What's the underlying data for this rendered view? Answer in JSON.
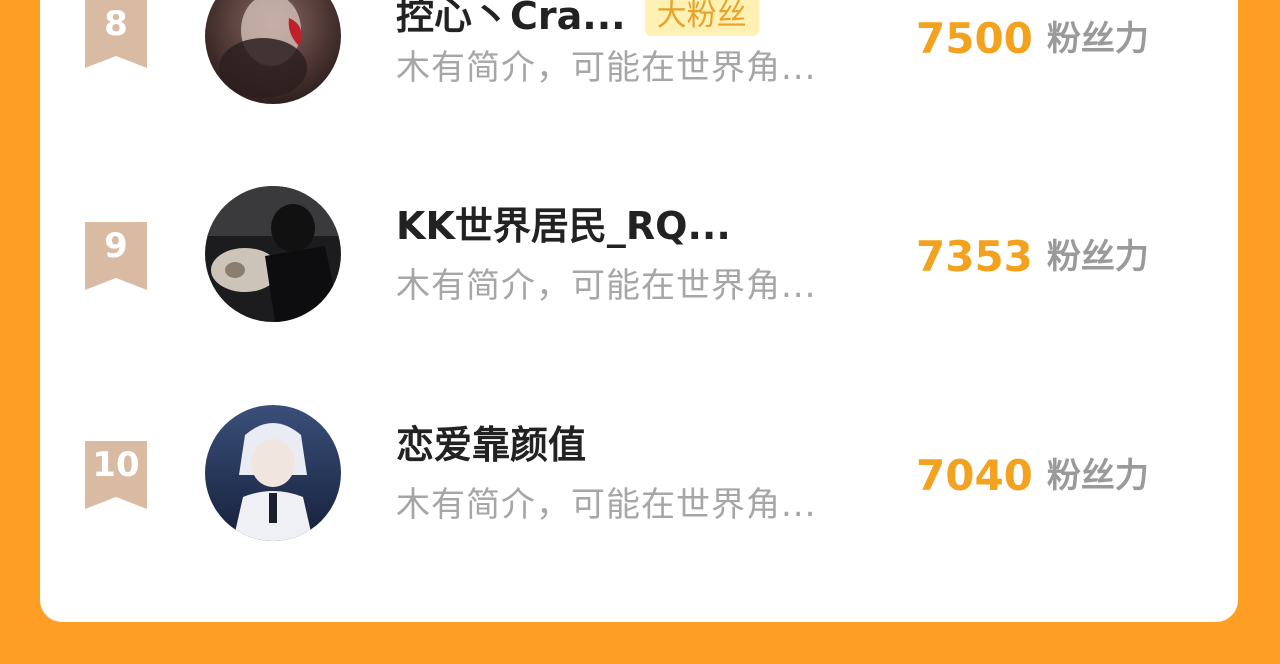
{
  "score_unit": "粉丝力",
  "colors": {
    "background": "#FF9E24",
    "card": "#FFFFFF",
    "rank_badge": "#D9BBA4",
    "score": "#F3A21F",
    "badge_bg": "#FFF0B3",
    "badge_text": "#E7A22A"
  },
  "rows": [
    {
      "rank": "8",
      "name": "控心丶Cra...",
      "badge": "大粉丝",
      "bio": "木有简介，可能在世界角...",
      "score": "7500"
    },
    {
      "rank": "9",
      "name": "KK世界居民_RQ...",
      "bio": "木有简介，可能在世界角...",
      "score": "7353"
    },
    {
      "rank": "10",
      "name": "恋爱靠颜值",
      "bio": "木有简介，可能在世界角...",
      "score": "7040"
    }
  ]
}
